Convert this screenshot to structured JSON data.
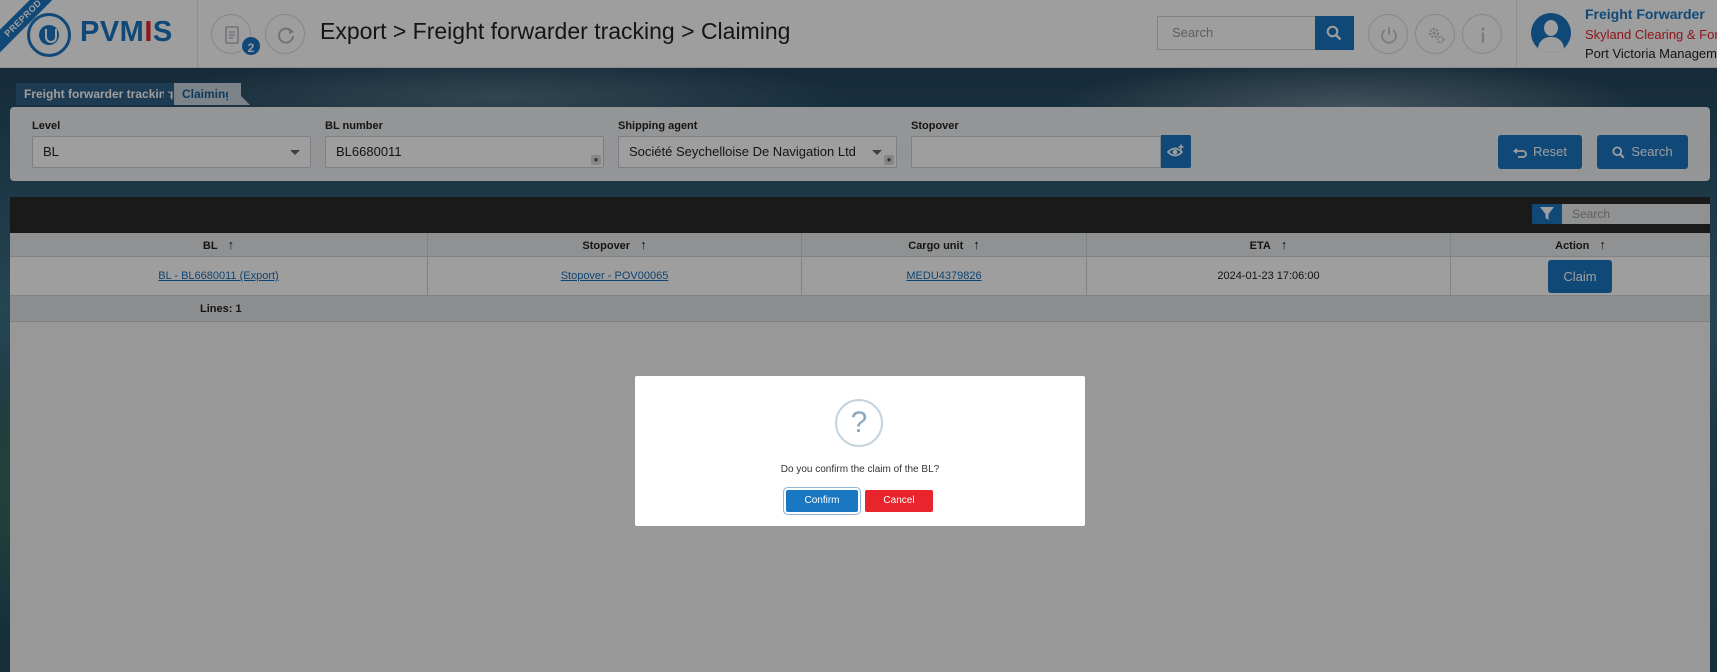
{
  "header": {
    "env_badge": "PREPROD",
    "logo": {
      "text_pre": "PVM",
      "text_accent": "I",
      "text_post": "S"
    },
    "notification_count": "2",
    "breadcrumb": "Export > Freight forwarder tracking > Claiming",
    "search": {
      "placeholder": "Search"
    },
    "user": {
      "role": "Freight Forwarder",
      "company": "Skyland Clearing & Forwarding",
      "organization": "Port Victoria Management"
    }
  },
  "tabs": [
    {
      "label": "Freight forwarder tracking"
    },
    {
      "label": "Claiming"
    }
  ],
  "filters": {
    "level": {
      "label": "Level",
      "value": "BL"
    },
    "bl_number": {
      "label": "BL number",
      "value": "BL6680011"
    },
    "shipping_agent": {
      "label": "Shipping agent",
      "value": "Société Seychelloise De Navigation Ltd"
    },
    "stopover": {
      "label": "Stopover",
      "value": ""
    },
    "reset_label": "Reset",
    "search_label": "Search"
  },
  "table": {
    "search_placeholder": "Search",
    "columns": [
      {
        "label": "BL"
      },
      {
        "label": "Stopover"
      },
      {
        "label": "Cargo unit"
      },
      {
        "label": "ETA"
      },
      {
        "label": "Action"
      }
    ],
    "rows": [
      {
        "bl": "BL - BL6680011 (Export)",
        "stopover": "Stopover - POV00065",
        "cargo_unit": "MEDU4379826",
        "eta": "2024-01-23 17:06:00",
        "action": "Claim"
      }
    ],
    "footer": "Lines: 1"
  },
  "modal": {
    "icon": "?",
    "message": "Do you confirm the claim of the BL?",
    "confirm_label": "Confirm",
    "cancel_label": "Cancel"
  },
  "colors": {
    "primary": "#1a77c2",
    "danger": "#e8242d"
  }
}
